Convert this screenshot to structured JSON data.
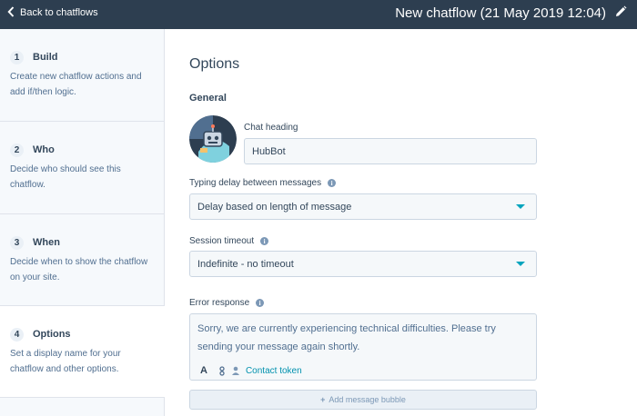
{
  "topbar": {
    "back_label": "Back to chatflows",
    "title": "New chatflow (21 May 2019 12:04)"
  },
  "sidebar": {
    "steps": [
      {
        "number": "1",
        "title": "Build",
        "description": "Create new chatflow actions and add if/then logic."
      },
      {
        "number": "2",
        "title": "Who",
        "description": "Decide who should see this chatflow."
      },
      {
        "number": "3",
        "title": "When",
        "description": "Decide when to show the chatflow on your site."
      },
      {
        "number": "4",
        "title": "Options",
        "description": "Set a display name for your chatflow and other options."
      }
    ]
  },
  "main": {
    "title": "Options",
    "section_title": "General",
    "chat_heading": {
      "label": "Chat heading",
      "value": "HubBot"
    },
    "typing_delay": {
      "label": "Typing delay between messages",
      "value": "Delay based on length of message"
    },
    "session_timeout": {
      "label": "Session timeout",
      "value": "Indefinite - no timeout"
    },
    "error_response": {
      "label": "Error response",
      "value": "Sorry, we are currently experiencing technical difficulties. Please try sending your message again shortly.",
      "contact_token_label": "Contact token"
    },
    "add_bubble_label": "Add message bubble"
  },
  "colors": {
    "topbar_bg": "#2d3e50",
    "sidebar_bg": "#f6f9fc",
    "accent": "#00a4bd",
    "link": "#0091ae",
    "text": "#33475b"
  },
  "icons": [
    "chevron-left-icon",
    "pencil-icon",
    "info-icon",
    "bot-avatar",
    "bold-icon",
    "personalize-icon",
    "contact-icon",
    "caret-down-icon",
    "plus-icon"
  ]
}
